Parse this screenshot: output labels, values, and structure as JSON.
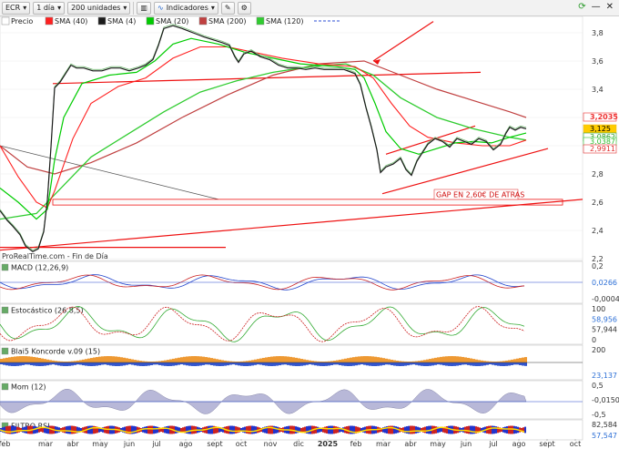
{
  "toolbar": {
    "symbol": "ECR",
    "period": "1 día",
    "units": "200 unidades",
    "indicators": "Indicadores"
  },
  "price_panel": {
    "legend": [
      "Precio",
      "SMA (40)",
      "SMA (4)",
      "SMA (20)",
      "SMA (200)",
      "SMA (120)"
    ],
    "yticks": [
      "3,8",
      "3,6",
      "3,4",
      "3,2",
      "3,0",
      "2,8",
      "2,6",
      "2,4",
      "2,2"
    ],
    "badges": [
      "3,2035",
      "3,125",
      "3,0862",
      "3,0387",
      "2,9911"
    ],
    "annotation": "GAP EN 2,60€ DE ATRAS",
    "source": "ProRealTime.com - Fin de Día"
  },
  "subpanels": {
    "macd": {
      "title": "MACD (12,26,9)",
      "ticks": [
        "0,2",
        "0,0266",
        "-0,0004"
      ]
    },
    "stoch": {
      "title": "Estocástico (26,8,5)",
      "ticks": [
        "100",
        "58,956",
        "57,944",
        "0"
      ]
    },
    "blai5": {
      "title": "Blai5 Koncorde v.09 (15)",
      "ticks": [
        "200",
        "23,137"
      ]
    },
    "mom": {
      "title": "Mom (12)",
      "ticks": [
        "0,5",
        "-0,0150",
        "-0,5"
      ]
    },
    "rsi": {
      "title": "FILTRO RSI",
      "ticks": [
        "82,584",
        "57,547"
      ]
    }
  },
  "xaxis": [
    "feb",
    "mar",
    "abr",
    "may",
    "jun",
    "jul",
    "ago",
    "sept",
    "oct",
    "nov",
    "dic",
    "2025",
    "feb",
    "mar",
    "abr",
    "may",
    "jun",
    "jul",
    "ago",
    "sept",
    "oct"
  ],
  "colors": {
    "price": "#000000",
    "sma40": "#ff2020",
    "sma4": "#1a1a1a",
    "sma20": "#00cc00",
    "sma200": "#c04040",
    "sma120": "#30cc30",
    "trend": "#ee1111",
    "accent": "#2c6fd6"
  }
}
